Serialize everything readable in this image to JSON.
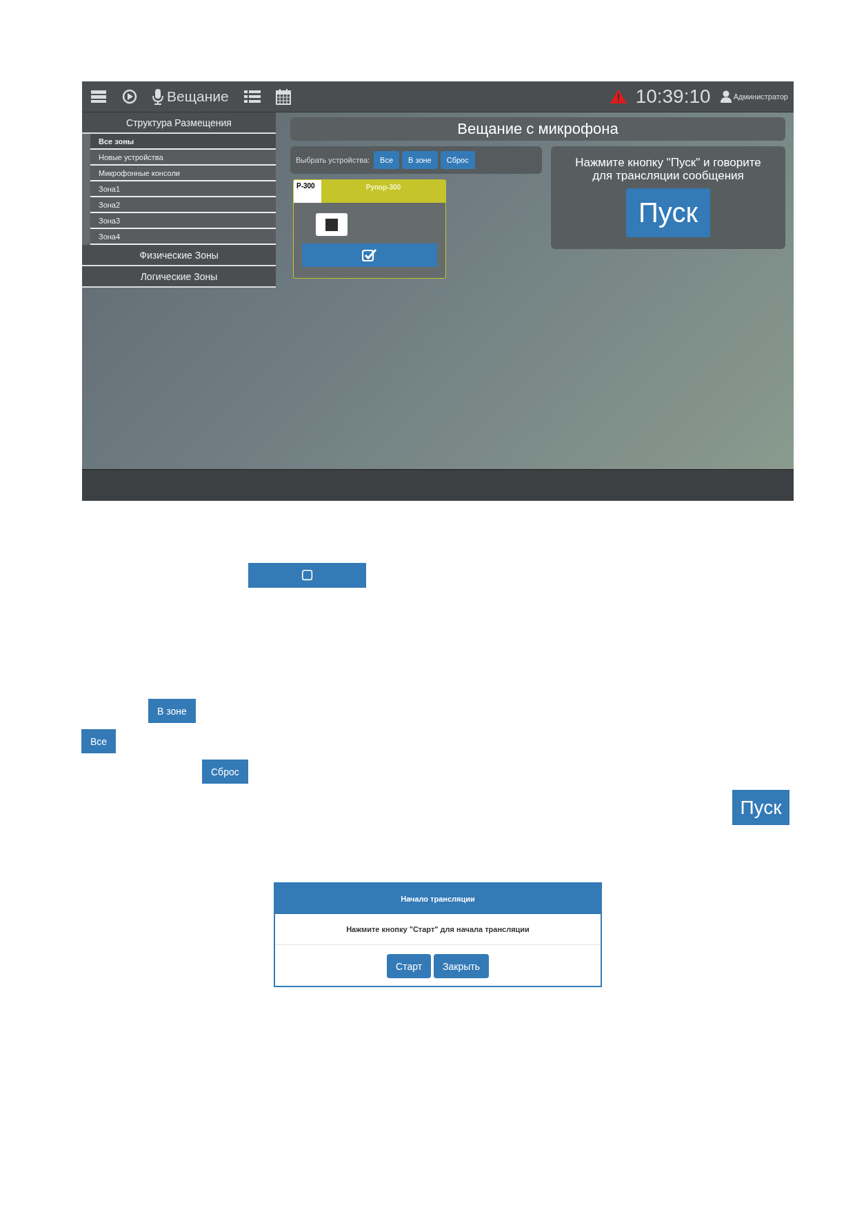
{
  "toolbar": {
    "title": "Вещание",
    "clock": "10:39:10",
    "user": "Администратор"
  },
  "sidebar": {
    "sections": [
      {
        "label": "Структура Размещения",
        "items": [
          {
            "label": "Все зоны",
            "selected": true
          },
          {
            "label": "Новые устройства",
            "selected": false
          },
          {
            "label": "Микрофонные консоли",
            "selected": false
          },
          {
            "label": "Зона1",
            "selected": false
          },
          {
            "label": "Зона2",
            "selected": false
          },
          {
            "label": "Зона3",
            "selected": false
          },
          {
            "label": "Зона4",
            "selected": false
          }
        ]
      },
      {
        "label": "Физические Зоны"
      },
      {
        "label": "Логические Зоны"
      }
    ]
  },
  "main": {
    "title": "Вещание с микрофона",
    "filter": {
      "label": "Выбрать устройства:",
      "buttons": [
        "Все",
        "В зоне",
        "Сброс"
      ]
    },
    "device": {
      "code": "P-300",
      "name": "Рупор-300",
      "checked": true
    },
    "hint": "Нажмите кнопку \"Пуск\" и говорите для трансляции сообщения",
    "start_button": "Пуск"
  },
  "loose_controls": {
    "checkbox_button": {
      "checked": false
    },
    "buttons": [
      "В зоне",
      "Все",
      "Сброс"
    ],
    "start_button": "Пуск"
  },
  "dialog": {
    "title": "Начало трансляции",
    "message": "Нажмите кнопку \"Старт\" для начала трансляции",
    "buttons": [
      "Старт",
      "Закрыть"
    ]
  }
}
